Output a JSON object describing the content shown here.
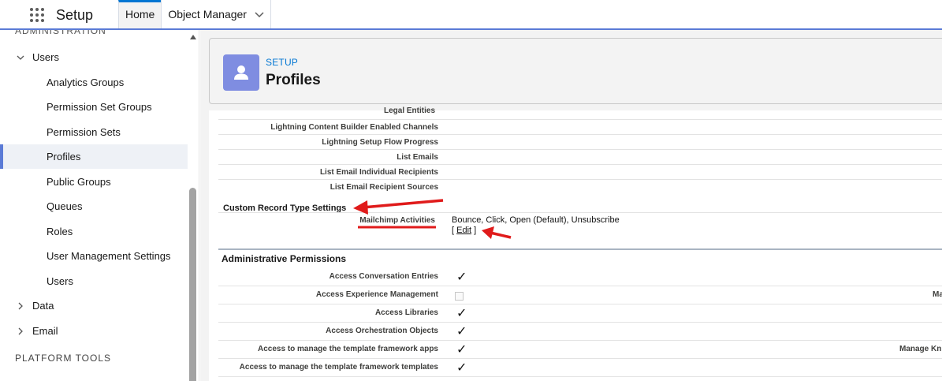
{
  "topbar": {
    "app_name": "Setup",
    "tabs": [
      {
        "label": "Home",
        "active": true
      },
      {
        "label": "Object Manager",
        "active": false
      }
    ]
  },
  "sidebar": {
    "cut_heading": "ADMINISTRATION",
    "users_label": "Users",
    "items": [
      "Analytics Groups",
      "Permission Set Groups",
      "Permission Sets",
      "Profiles",
      "Public Groups",
      "Queues",
      "Roles",
      "User Management Settings",
      "Users"
    ],
    "selected": "Profiles",
    "data_label": "Data",
    "email_label": "Email",
    "platform_tools": "PLATFORM TOOLS"
  },
  "header": {
    "eyebrow": "SETUP",
    "title": "Profiles"
  },
  "content": {
    "cut_row": "Legal Entities",
    "rows_top": [
      "Lightning Content Builder Enabled Channels",
      "Lightning Setup Flow Progress",
      "List Emails",
      "List Email Individual Recipients",
      "List Email Recipient Sources"
    ],
    "custom_record": {
      "title": "Custom Record Type Settings",
      "label": "Mailchimp Activities",
      "value": "Bounce, Click, Open (Default), Unsubscribe",
      "edit_open": "[",
      "edit_label": "Edit",
      "edit_close": "]"
    },
    "admin": {
      "title": "Administrative Permissions",
      "rows": [
        {
          "label": "Access Conversation Entries",
          "checked": true
        },
        {
          "label": "Access Experience Management",
          "checked": false
        },
        {
          "label": "Access Libraries",
          "checked": true
        },
        {
          "label": "Access Orchestration Objects",
          "checked": true
        },
        {
          "label": "Access to manage the template framework apps",
          "checked": true
        },
        {
          "label": "Access to manage the template framework templates",
          "checked": true
        }
      ],
      "right_cut_1": "Ma",
      "right_cut_2": "Manage Kn"
    },
    "check_glyph": "✓",
    "annotation_color": "#e01b1b"
  }
}
